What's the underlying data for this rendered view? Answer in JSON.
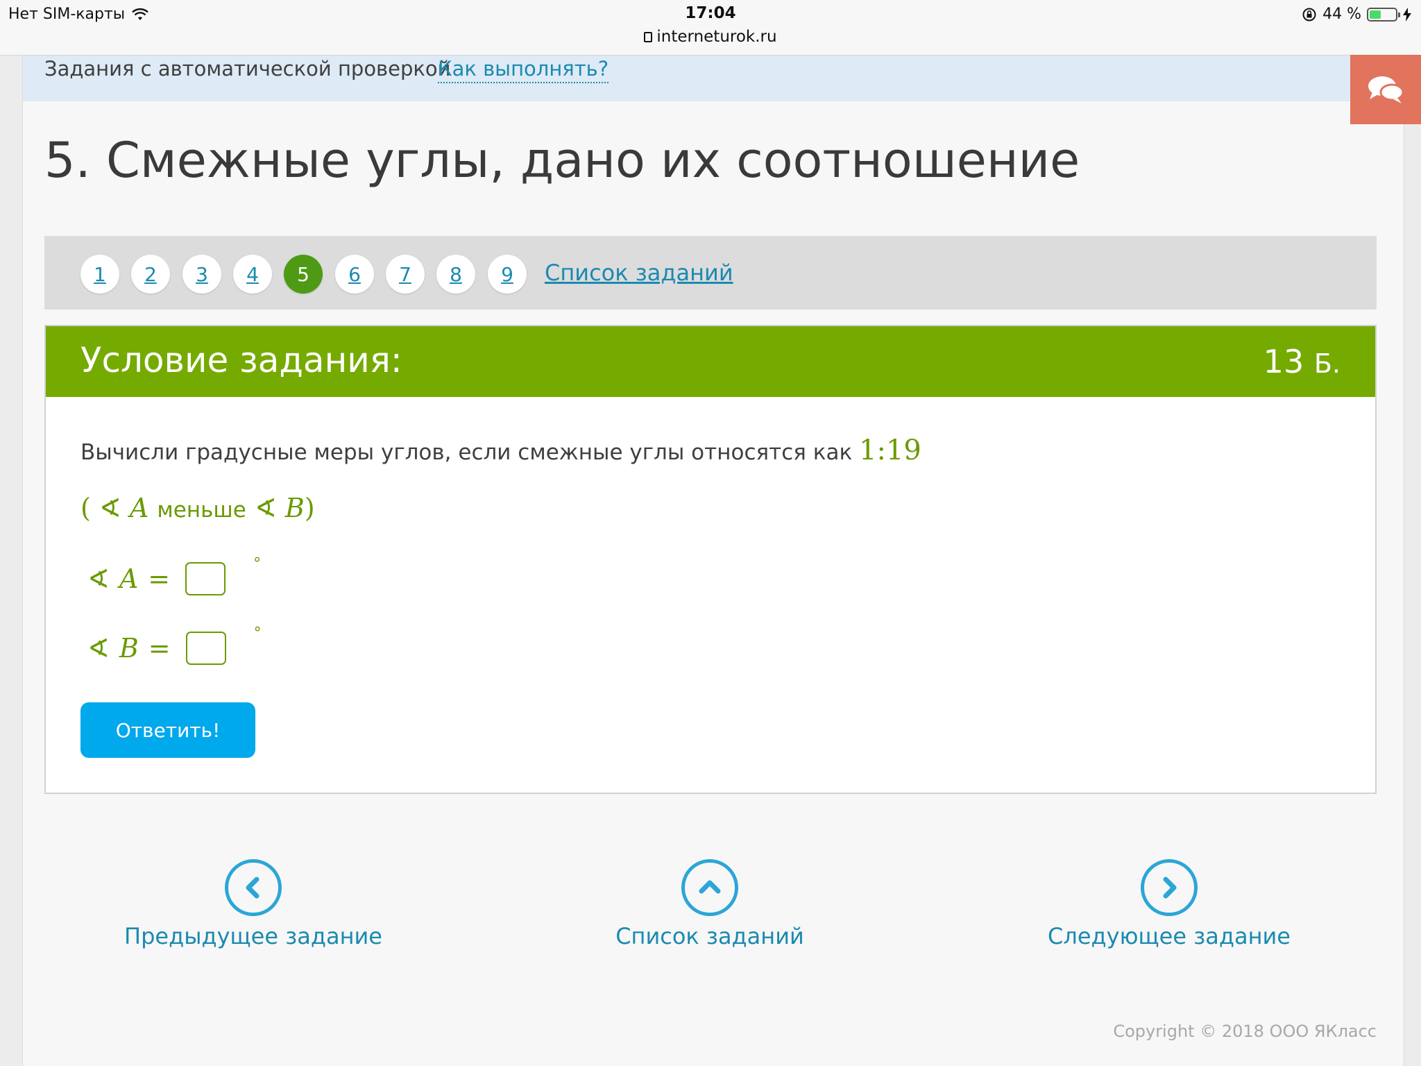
{
  "status_bar": {
    "carrier": "Нет SIM-карты",
    "time": "17:04",
    "url": "interneturok.ru",
    "battery": "44 %",
    "battery_level": 0.44
  },
  "topstrip": {
    "label": "Задания с автоматической проверкой",
    "help_link": "Как выполнять?"
  },
  "page_title": "5. Смежные углы, дано их соотношение",
  "task_nav": {
    "pills": [
      "1",
      "2",
      "3",
      "4",
      "5",
      "6",
      "7",
      "8",
      "9"
    ],
    "active": "5",
    "list_link": "Список заданий"
  },
  "condition": {
    "header": "Условие задания:",
    "score_value": "13",
    "score_unit": "Б.",
    "text": "Вычисли градусные меры углов, если смежные углы относятся как",
    "ratio": "1:19",
    "hint": {
      "angle_sym": "∢",
      "a": "A",
      "word": "меньше",
      "b": "B",
      "open": "(",
      "close": ")"
    },
    "eq_a": {
      "angle_sym": "∢",
      "var": "A",
      "eq": "=",
      "deg": "°"
    },
    "eq_b": {
      "angle_sym": "∢",
      "var": "B",
      "eq": "=",
      "deg": "°"
    },
    "submit_label": "Ответить!"
  },
  "bottom_nav": {
    "prev_label": "Предыдущее задание",
    "list_label": "Список заданий",
    "next_label": "Следующее задание"
  },
  "copyright": "Copyright © 2018 ООО ЯКласс",
  "colors": {
    "accent_green": "#75aa00",
    "link_blue": "#1a8ab0",
    "button_blue": "#00a8ec",
    "chat_orange": "#e2735c"
  }
}
